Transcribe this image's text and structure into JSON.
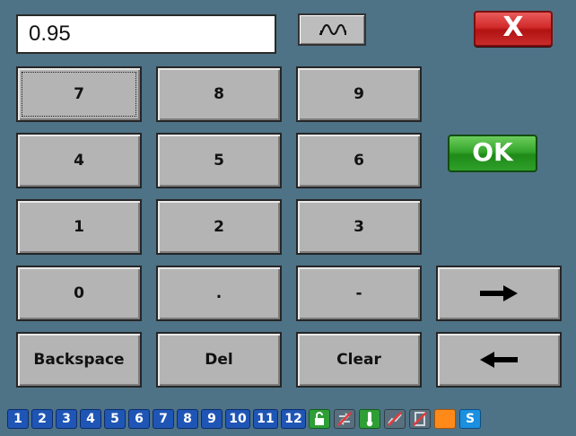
{
  "display": {
    "value": "0.95"
  },
  "top": {
    "close_label": "X",
    "ok_label": "OK",
    "special_icon": "signal-wave-icon"
  },
  "keys": {
    "k7": "7",
    "k8": "8",
    "k9": "9",
    "k4": "4",
    "k5": "5",
    "k6": "6",
    "k1": "1",
    "k2": "2",
    "k3": "3",
    "k0": "0",
    "dot": ".",
    "minus": "-",
    "backspace": "Backspace",
    "del": "Del",
    "clear": "Clear",
    "right_arrow": "→",
    "left_arrow": "←"
  },
  "taskbar": {
    "numbers": [
      "1",
      "2",
      "3",
      "4",
      "5",
      "6",
      "7",
      "8",
      "9",
      "10",
      "11",
      "12"
    ],
    "status_icons": [
      {
        "name": "lock-icon",
        "color": "#2e9e35"
      },
      {
        "name": "swap-crossed-icon",
        "color": "#5a6f7d"
      },
      {
        "name": "thermometer-icon",
        "color": "#2e9e35"
      },
      {
        "name": "chart-crossed-icon",
        "color": "#5a6f7d"
      },
      {
        "name": "document-crossed-icon",
        "color": "#5a6f7d"
      },
      {
        "name": "orange-square-icon",
        "color": "#ff8a1a"
      },
      {
        "name": "s-icon",
        "color": "#1b8fe0",
        "label": "S"
      }
    ]
  }
}
